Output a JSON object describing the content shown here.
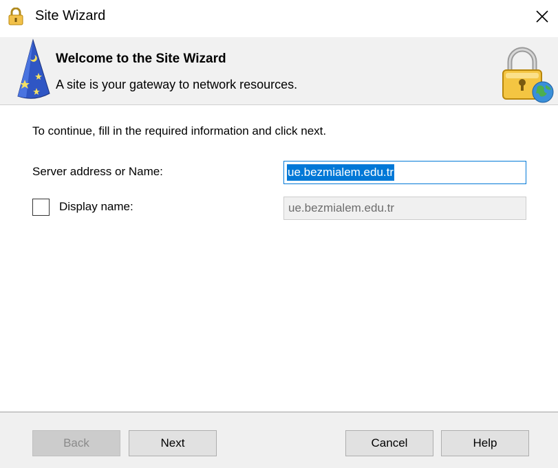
{
  "window": {
    "title": "Site Wizard",
    "icon": "lock-icon",
    "close_icon": "close-icon"
  },
  "header": {
    "title": "Welcome to the Site Wizard",
    "subtitle": "A site is your gateway to network resources.",
    "left_icon": "wizard-hat-icon",
    "right_icon": "lock-globe-icon"
  },
  "form": {
    "instructions": "To continue, fill in the required information and click next.",
    "server_label": "Server address or Name:",
    "server_value": "ue.bezmialem.edu.tr",
    "display_label": "Display name:",
    "display_checked": false,
    "display_value": "ue.bezmialem.edu.tr"
  },
  "buttons": {
    "back": "Back",
    "next": "Next",
    "cancel": "Cancel",
    "help": "Help"
  },
  "colors": {
    "accent": "#0078d7",
    "header_bg": "#f1f1f1",
    "footer_bg": "#f0f0f0"
  }
}
